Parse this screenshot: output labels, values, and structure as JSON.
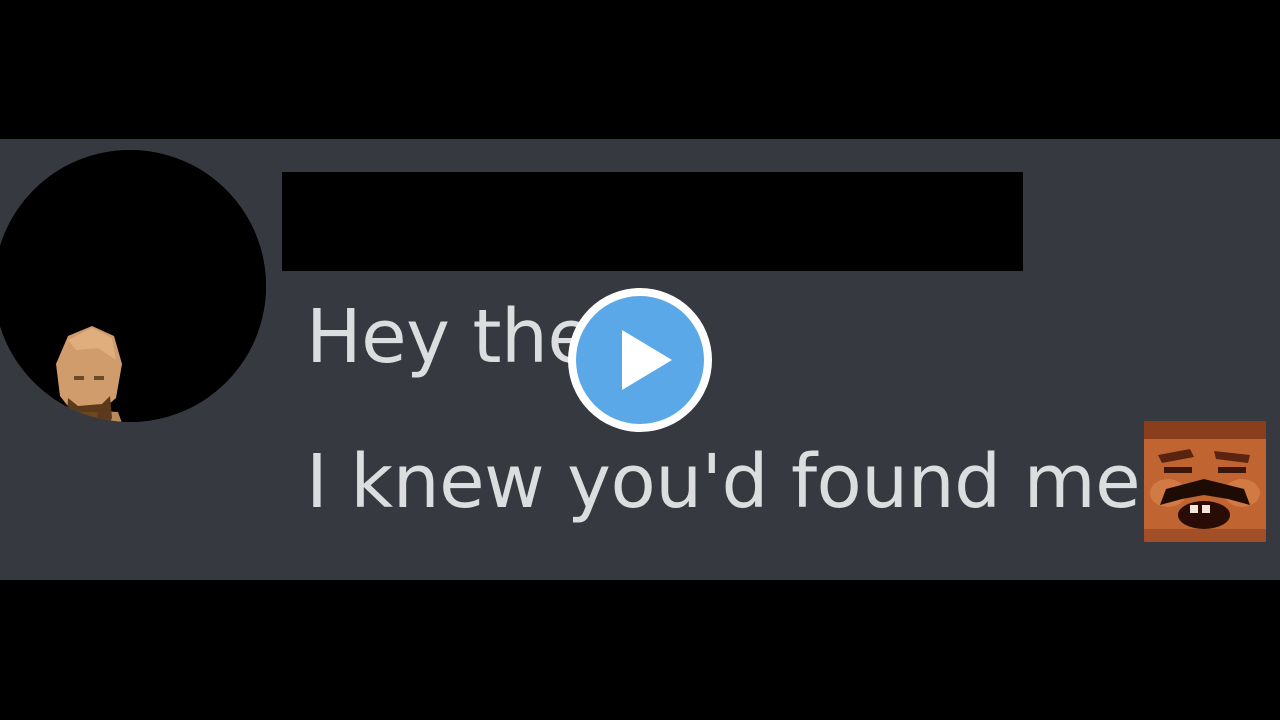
{
  "message": {
    "line1": "Hey the",
    "line2": "I knew you'd found me"
  },
  "icons": {
    "avatar": "bearded-character-avatar",
    "emoji": "laughing-man-emoji",
    "play": "play-icon"
  },
  "colors": {
    "background": "#000000",
    "message_band": "#36393f",
    "message_text": "#dcddde",
    "redaction": "#000000",
    "play_button": "#5ba8e8",
    "play_ring": "#ffffff"
  }
}
